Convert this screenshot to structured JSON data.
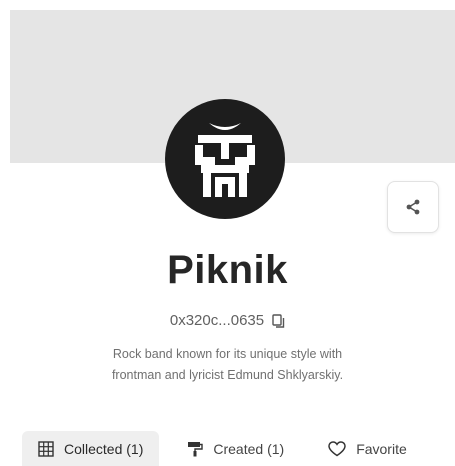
{
  "profile": {
    "name": "Piknik",
    "address": "0x320c...0635",
    "bio_line1": "Rock band known for its unique style with",
    "bio_line2": "frontman and lyricist Edmund Shklyarskiy."
  },
  "tabs": [
    {
      "label": "Collected (1)",
      "icon": "grid-icon",
      "active": true
    },
    {
      "label": "Created (1)",
      "icon": "paint-roller-icon",
      "active": false
    },
    {
      "label": "Favorite",
      "icon": "heart-icon",
      "active": false
    }
  ],
  "icons": {
    "share": "share-icon",
    "copy": "copy-icon"
  },
  "colors": {
    "banner": "#e5e5e5",
    "avatar_bg": "#1d1d1d",
    "active_tab_bg": "#efefef",
    "title_text": "#262626"
  }
}
